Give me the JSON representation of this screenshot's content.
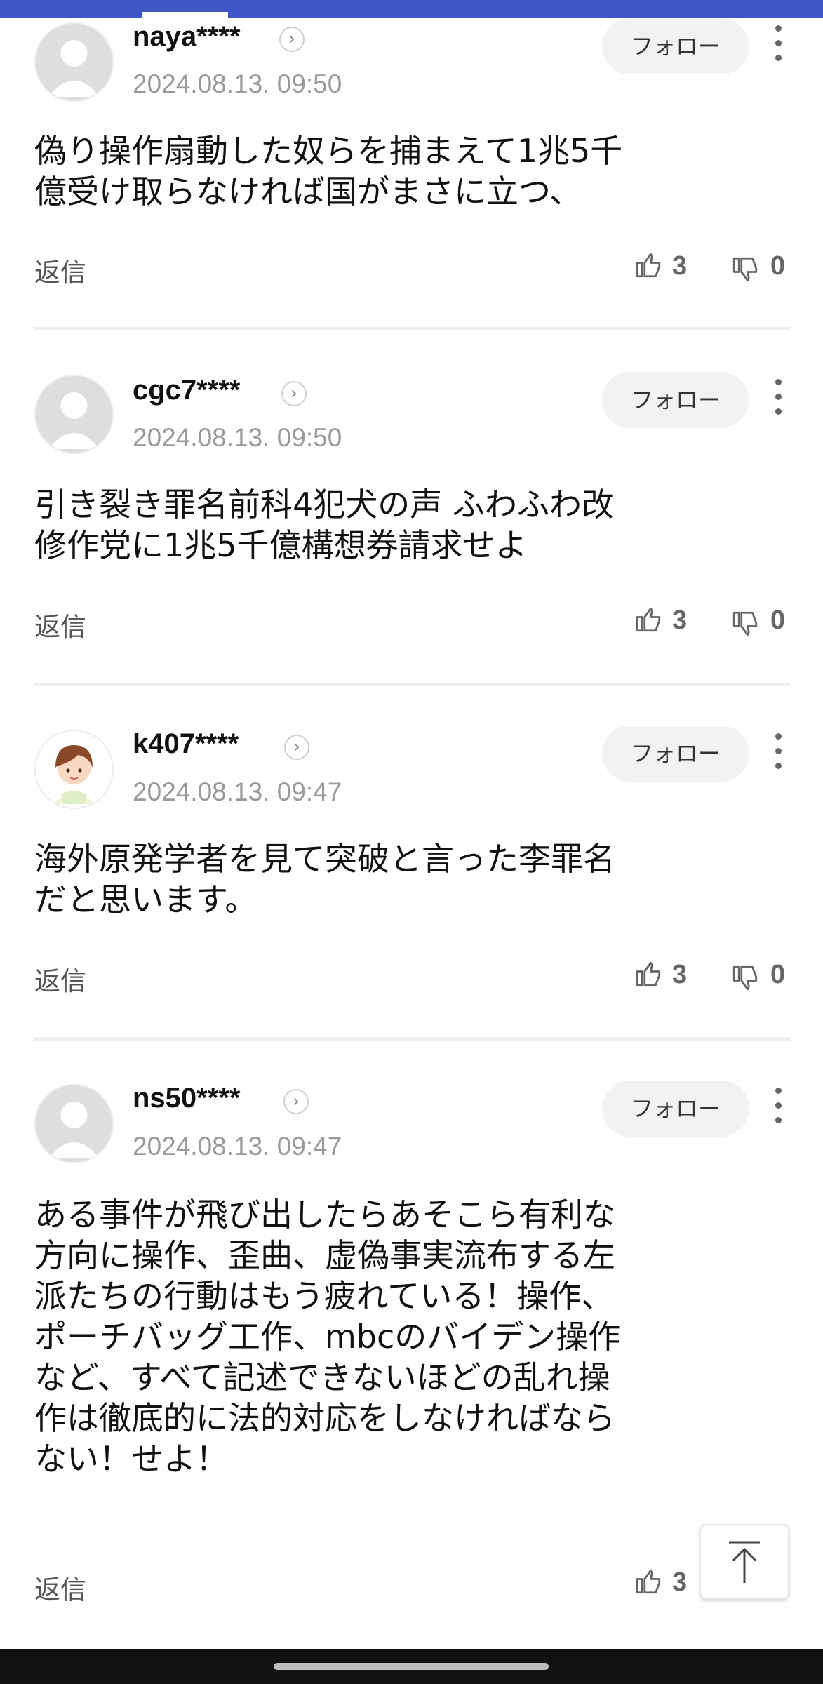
{
  "comments": [
    {
      "username": "naya****",
      "date": "2024.08.13. 09:50",
      "text": "偽り操作扇動した奴らを捕まえて1兆5千\n億受け取らなければ国がまさに立つ、",
      "follow_label": "フォロー",
      "reply_label": "返信",
      "likes": "3",
      "dislikes": "0",
      "avatar": "default-person"
    },
    {
      "username": "cgc7****",
      "date": "2024.08.13. 09:50",
      "text": "引き裂き罪名前科4犯犬の声 ふわふわ改\n修作党に1兆5千億構想券請求せよ",
      "follow_label": "フォロー",
      "reply_label": "返信",
      "likes": "3",
      "dislikes": "0",
      "avatar": "default-person"
    },
    {
      "username": "k407****",
      "date": "2024.08.13. 09:47",
      "text": "海外原発学者を見て突破と言った李罪名\nだと思います。",
      "follow_label": "フォロー",
      "reply_label": "返信",
      "likes": "3",
      "dislikes": "0",
      "avatar": "cartoon-person"
    },
    {
      "username": "ns50****",
      "date": "2024.08.13. 09:47",
      "text": "ある事件が飛び出したらあそこら有利な\n方向に操作、歪曲、虚偽事実流布する左\n派たちの行動はもう疲れている！操作、\nポーチバッグ工作、mbcのバイデン操作\nなど、すべて記述できないほどの乱れ操\n作は徹底的に法的対応をしなければなら\nない！せよ！",
      "follow_label": "フォロー",
      "reply_label": "返信",
      "likes": "3",
      "dislikes": "",
      "avatar": "default-person"
    }
  ],
  "icons": {
    "like": "thumbs-up-icon",
    "dislike": "thumbs-down-icon",
    "profile_link": "chevron-right-icon",
    "menu": "more-vertical-icon",
    "scroll_top": "arrow-up-icon"
  },
  "colors": {
    "top_bar": "#3f57c6",
    "follow_bg": "#f2f2f2",
    "date_text": "#9a9a9a"
  }
}
